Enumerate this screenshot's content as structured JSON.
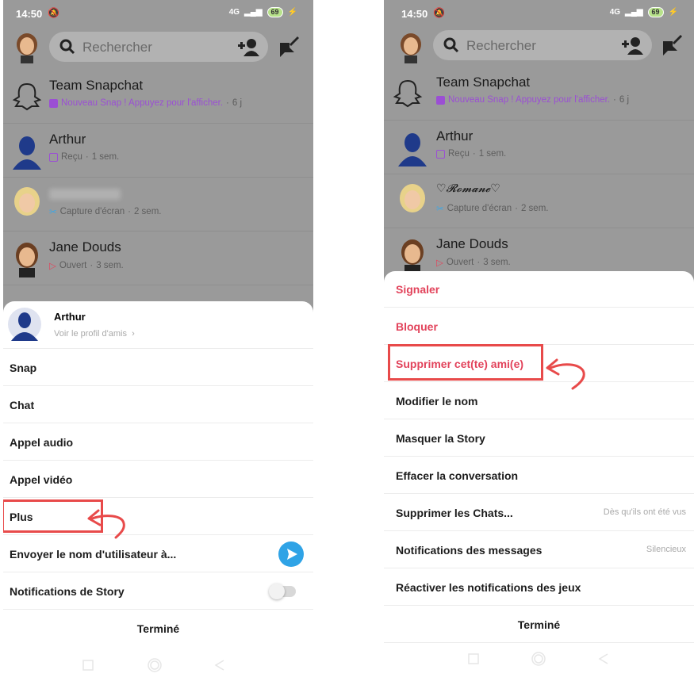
{
  "status": {
    "time": "14:50",
    "network": "4G",
    "battery": "69"
  },
  "search": {
    "placeholder": "Rechercher"
  },
  "left": {
    "chats": [
      {
        "name": "Team Snapchat",
        "status_text": "Nouveau Snap ! Appuyez pour l'afficher.",
        "time": "6 j",
        "status_type": "new-snap",
        "color": "#9b4fd4"
      },
      {
        "name": "Arthur",
        "status_text": "Reçu",
        "time": "1 sem.",
        "status_type": "received",
        "color": "#9b4fd4"
      },
      {
        "name": "",
        "status_text": "Capture d'écran",
        "time": "2 sem.",
        "status_type": "screenshot",
        "color": "#3fa7e4"
      },
      {
        "name": "Jane Douds",
        "status_text": "Ouvert",
        "time": "3 sem.",
        "status_type": "opened",
        "color": "#e2435b"
      }
    ],
    "profile": {
      "name": "Arthur",
      "link": "Voir le profil d'amis"
    },
    "menu": [
      "Snap",
      "Chat",
      "Appel audio",
      "Appel vidéo",
      "Plus",
      "Envoyer le nom d'utilisateur à...",
      "Notifications de Story"
    ],
    "done": "Terminé"
  },
  "right": {
    "chats": [
      {
        "name": "Team Snapchat",
        "status_text": "Nouveau Snap ! Appuyez pour l'afficher.",
        "time": "6 j"
      },
      {
        "name": "Arthur",
        "status_text": "Reçu",
        "time": "1 sem."
      },
      {
        "name": "♡𝓡𝓸𝓶𝓪𝓷𝓮♡",
        "status_text": "Capture d'écran",
        "time": "2 sem."
      },
      {
        "name": "Jane Douds",
        "status_text": "Ouvert",
        "time": "3 sem."
      }
    ],
    "menu": [
      {
        "label": "Signaler",
        "hint": "",
        "danger": true
      },
      {
        "label": "Bloquer",
        "hint": "",
        "danger": true
      },
      {
        "label": "Supprimer cet(te) ami(e)",
        "hint": "",
        "danger": true
      },
      {
        "label": "Modifier le nom",
        "hint": "",
        "danger": false
      },
      {
        "label": "Masquer la Story",
        "hint": "",
        "danger": false
      },
      {
        "label": "Effacer la conversation",
        "hint": "",
        "danger": false
      },
      {
        "label": "Supprimer les Chats...",
        "hint": "Dès qu'ils ont été vus",
        "danger": false
      },
      {
        "label": "Notifications des messages",
        "hint": "Silencieux",
        "danger": false
      },
      {
        "label": "Réactiver les notifications des jeux",
        "hint": "",
        "danger": false
      }
    ],
    "done": "Terminé"
  },
  "colors": {
    "accent_red": "#e84a4a",
    "danger_text": "#e2435b",
    "send_blue": "#2fa3e6"
  }
}
